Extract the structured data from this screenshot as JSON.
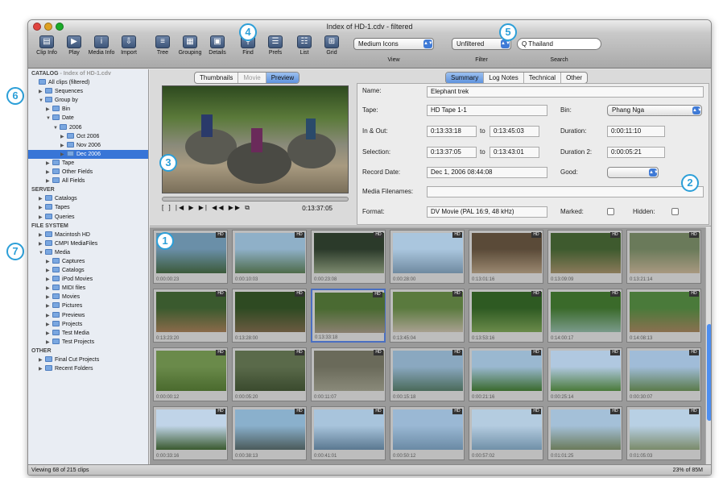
{
  "window": {
    "title": "Index of HD-1.cdv - filtered"
  },
  "toolbar": {
    "buttons": [
      {
        "label": "Clip Info",
        "icon": "clip-info-icon",
        "glyph": "▤"
      },
      {
        "label": "Play",
        "icon": "play-icon",
        "glyph": "▶"
      },
      {
        "label": "Media Info",
        "icon": "info-icon",
        "glyph": "i"
      },
      {
        "label": "Import",
        "icon": "import-icon",
        "glyph": "⇩"
      },
      {
        "label": "Tree",
        "icon": "tree-icon",
        "glyph": "≡"
      },
      {
        "label": "Grouping",
        "icon": "grouping-icon",
        "glyph": "▦"
      },
      {
        "label": "Details",
        "icon": "details-icon",
        "glyph": "▣"
      },
      {
        "label": "Find",
        "icon": "find-icon",
        "glyph": "⚲"
      },
      {
        "label": "Prefs",
        "icon": "prefs-icon",
        "glyph": "☰"
      },
      {
        "label": "List",
        "icon": "list-icon",
        "glyph": "☷"
      },
      {
        "label": "Grid",
        "icon": "grid-icon",
        "glyph": "⊞"
      }
    ],
    "view_select": "Medium Icons",
    "view_label": "View",
    "filter_select": "Unfiltered",
    "filter_label": "Filter",
    "search_value": "Q Thailand",
    "search_label": "Search"
  },
  "sidebar": {
    "rows": [
      {
        "text": "CATALOG",
        "suffix": " - Index of HD-1.cdv",
        "indent": 0,
        "kind": "head"
      },
      {
        "text": "All clips (filtered)",
        "indent": 1,
        "kind": "item"
      },
      {
        "text": "Sequences",
        "indent": 1,
        "kind": "item",
        "tri": "▶"
      },
      {
        "text": "Group by",
        "indent": 1,
        "kind": "item",
        "tri": "▼"
      },
      {
        "text": "Bin",
        "indent": 2,
        "kind": "item",
        "tri": "▶"
      },
      {
        "text": "Date",
        "indent": 2,
        "kind": "item",
        "tri": "▼"
      },
      {
        "text": "2006",
        "indent": 3,
        "kind": "item",
        "tri": "▼"
      },
      {
        "text": "Oct 2006",
        "indent": 4,
        "kind": "item",
        "tri": "▶"
      },
      {
        "text": "Nov 2006",
        "indent": 4,
        "kind": "item",
        "tri": "▶"
      },
      {
        "text": "Dec 2006",
        "indent": 4,
        "kind": "sel",
        "tri": "▶"
      },
      {
        "text": "Tape",
        "indent": 2,
        "kind": "item",
        "tri": "▶"
      },
      {
        "text": "Other Fields",
        "indent": 2,
        "kind": "item",
        "tri": "▶"
      },
      {
        "text": "All Fields",
        "indent": 2,
        "kind": "item",
        "tri": "▶"
      },
      {
        "text": "SERVER",
        "indent": 0,
        "kind": "head"
      },
      {
        "text": "Catalogs",
        "indent": 1,
        "kind": "item",
        "tri": "▶"
      },
      {
        "text": "Tapes",
        "indent": 1,
        "kind": "item",
        "tri": "▶"
      },
      {
        "text": "Queries",
        "indent": 1,
        "kind": "item",
        "tri": "▶"
      },
      {
        "text": "FILE SYSTEM",
        "indent": 0,
        "kind": "head"
      },
      {
        "text": "Macintosh HD",
        "indent": 1,
        "kind": "item",
        "tri": "▶"
      },
      {
        "text": "CMPI MediaFiles",
        "indent": 1,
        "kind": "item",
        "tri": "▶"
      },
      {
        "text": "Media",
        "indent": 1,
        "kind": "item",
        "tri": "▼"
      },
      {
        "text": "Captures",
        "indent": 2,
        "kind": "item",
        "tri": "▶"
      },
      {
        "text": "Catalogs",
        "indent": 2,
        "kind": "item",
        "tri": "▶"
      },
      {
        "text": "iPod Movies",
        "indent": 2,
        "kind": "item",
        "tri": "▶"
      },
      {
        "text": "MIDI files",
        "indent": 2,
        "kind": "item",
        "tri": "▶"
      },
      {
        "text": "Movies",
        "indent": 2,
        "kind": "item",
        "tri": "▶"
      },
      {
        "text": "Pictures",
        "indent": 2,
        "kind": "item",
        "tri": "▶"
      },
      {
        "text": "Previews",
        "indent": 2,
        "kind": "item",
        "tri": "▶"
      },
      {
        "text": "Projects",
        "indent": 2,
        "kind": "item",
        "tri": "▶"
      },
      {
        "text": "Test Media",
        "indent": 2,
        "kind": "item",
        "tri": "▶"
      },
      {
        "text": "Test Projects",
        "indent": 2,
        "kind": "item",
        "tri": "▶"
      },
      {
        "text": "OTHER",
        "indent": 0,
        "kind": "head"
      },
      {
        "text": "Final Cut Projects",
        "indent": 1,
        "kind": "item",
        "tri": "▶"
      },
      {
        "text": "Recent Folders",
        "indent": 1,
        "kind": "item",
        "tri": "▶"
      }
    ]
  },
  "preview_tabs": [
    {
      "label": "Thumbnails",
      "state": "normal"
    },
    {
      "label": "Movie",
      "state": "disabled"
    },
    {
      "label": "Preview",
      "state": "active"
    }
  ],
  "player": {
    "timecode": "0:13:37:05",
    "buttons": "[ ] |◀ ▶ ▶| ◀◀ ▶▶ ⧉"
  },
  "info_tabs": [
    {
      "label": "Summary",
      "state": "active"
    },
    {
      "label": "Log Notes",
      "state": "normal"
    },
    {
      "label": "Technical",
      "state": "normal"
    },
    {
      "label": "Other",
      "state": "normal"
    }
  ],
  "info": {
    "name_label": "Name:",
    "name": "Elephant trek",
    "tape_label": "Tape:",
    "tape": "HD Tape 1-1",
    "bin_label": "Bin:",
    "bin": "Phang Nga",
    "inout_label": "In & Out:",
    "in": "0:13:33:18",
    "to1": "to",
    "out": "0:13:45:03",
    "duration_label": "Duration:",
    "duration": "0:00:11:10",
    "selection_label": "Selection:",
    "sel_in": "0:13:37:05",
    "to2": "to",
    "sel_out": "0:13:43:01",
    "duration2_label": "Duration 2:",
    "duration2": "0:00:05:21",
    "record_label": "Record Date:",
    "record": "Dec 1, 2006 08:44:08",
    "good_label": "Good:",
    "filenames_label": "Media Filenames:",
    "format_label": "Format:",
    "format": "DV Movie (PAL 16:9, 48 kHz)",
    "marked_label": "Marked:",
    "hidden_label": "Hidden:"
  },
  "thumbnails": [
    {
      "cap": "0:00:00:23",
      "c1": "#6a8fa8",
      "c2": "#3c5a3a"
    },
    {
      "cap": "0:00:10:03",
      "c1": "#8fb0c8",
      "c2": "#4e6b4a"
    },
    {
      "cap": "0:00:23:08",
      "c1": "#2b3a2a",
      "c2": "#7c8a6e"
    },
    {
      "cap": "0:00:28:00",
      "c1": "#aac6de",
      "c2": "#6f8aa0"
    },
    {
      "cap": "0:13:01:16",
      "c1": "#5a4a38",
      "c2": "#9a8870"
    },
    {
      "cap": "0:13:09:09",
      "c1": "#3e5a2e",
      "c2": "#8a7a5a"
    },
    {
      "cap": "0:13:21:14",
      "c1": "#6a7a5a",
      "c2": "#a89880"
    },
    {
      "cap": "0:13:23:20",
      "c1": "#3a5a2e",
      "c2": "#8a6a4a"
    },
    {
      "cap": "0:13:28:00",
      "c1": "#2e4a22",
      "c2": "#6a5a40"
    },
    {
      "cap": "0:13:33:18",
      "c1": "#4a6a32",
      "c2": "#8a8070"
    },
    {
      "cap": "0:13:45:04",
      "c1": "#5a7a3e",
      "c2": "#a8a090"
    },
    {
      "cap": "0:13:53:16",
      "c1": "#2e5a22",
      "c2": "#6a8a4a"
    },
    {
      "cap": "0:14:00:17",
      "c1": "#3a6a2a",
      "c2": "#7a9a8a"
    },
    {
      "cap": "0:14:08:13",
      "c1": "#4a7a3a",
      "c2": "#8a7050"
    },
    {
      "cap": "0:00:00:12",
      "c1": "#6a8a4a",
      "c2": "#4a6a2e"
    },
    {
      "cap": "0:00:05:20",
      "c1": "#5a6a4a",
      "c2": "#3a4a2e"
    },
    {
      "cap": "0:00:11:07",
      "c1": "#6a6a5a",
      "c2": "#8a8a7a"
    },
    {
      "cap": "0:00:15:18",
      "c1": "#8aa8c0",
      "c2": "#4a6a5a"
    },
    {
      "cap": "0:00:21:16",
      "c1": "#9ab8d0",
      "c2": "#3a6a2e"
    },
    {
      "cap": "0:00:25:14",
      "c1": "#b0c8e0",
      "c2": "#4a7a3a"
    },
    {
      "cap": "0:00:30:07",
      "c1": "#a0bcd8",
      "c2": "#5a7a4a"
    },
    {
      "cap": "0:00:33:16",
      "c1": "#c0d4e8",
      "c2": "#3a5a2e"
    },
    {
      "cap": "0:00:38:13",
      "c1": "#8ab0cc",
      "c2": "#4a5a5a"
    },
    {
      "cap": "0:00:41:01",
      "c1": "#a8c4dc",
      "c2": "#5a7890"
    },
    {
      "cap": "0:00:50:12",
      "c1": "#9ab8d4",
      "c2": "#6a8aa4"
    },
    {
      "cap": "0:00:57:02",
      "c1": "#b4cce0",
      "c2": "#7090a8"
    },
    {
      "cap": "0:01:01:25",
      "c1": "#a4c0d8",
      "c2": "#6a7a5a"
    },
    {
      "cap": "0:01:05:03",
      "c1": "#b8d0e4",
      "c2": "#7a8a6a"
    }
  ],
  "status": {
    "left": "Viewing 68 of 215 clips",
    "right": "23% of 85M"
  },
  "callouts": [
    "1",
    "2",
    "3",
    "4",
    "5",
    "6",
    "7"
  ],
  "colors": {
    "accent": "#3875d7",
    "callout": "#2c9fd8"
  }
}
